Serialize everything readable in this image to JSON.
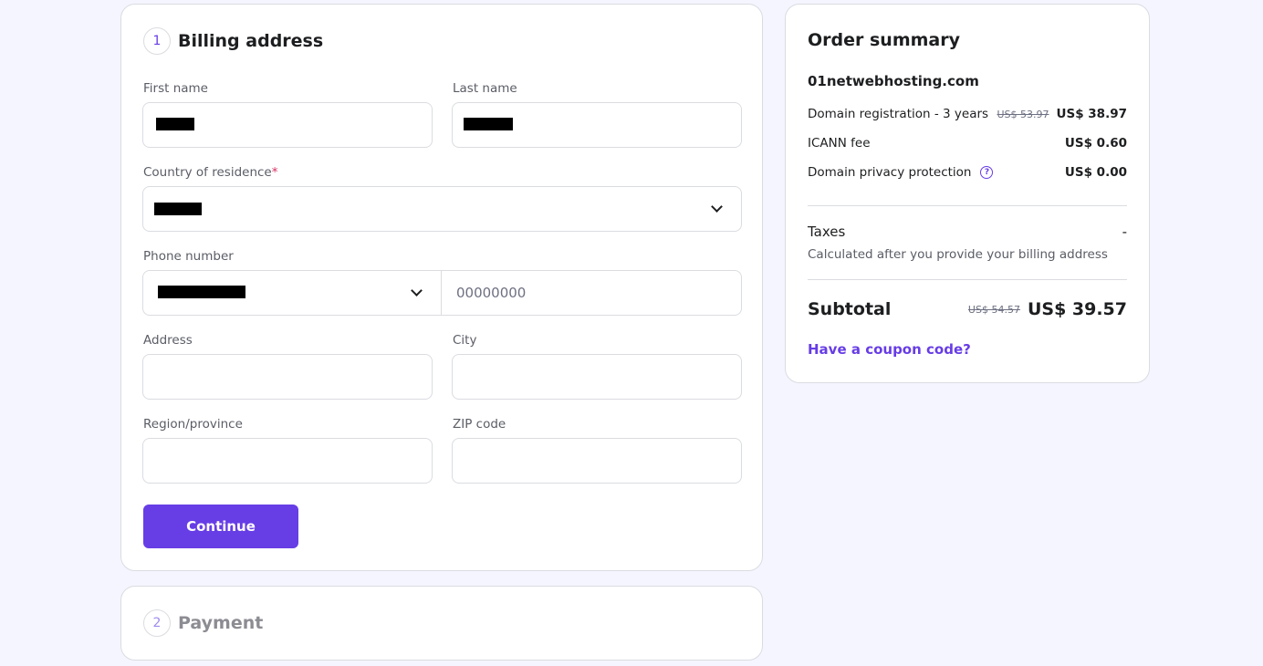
{
  "billing": {
    "step_number": "1",
    "title": "Billing address",
    "first_name_label": "First name",
    "last_name_label": "Last name",
    "country_label": "Country of residence",
    "required_marker": "*",
    "phone_label": "Phone number",
    "phone_placeholder": "00000000",
    "address_label": "Address",
    "city_label": "City",
    "region_label": "Region/province",
    "zip_label": "ZIP code",
    "continue_label": "Continue"
  },
  "payment": {
    "step_number": "2",
    "title": "Payment"
  },
  "summary": {
    "title": "Order summary",
    "domain": "01netwebhosting.com",
    "items": [
      {
        "label": "Domain registration - 3 years",
        "old_price": "US$ 53.97",
        "price": "US$ 38.97"
      },
      {
        "label": "ICANN fee",
        "old_price": "",
        "price": "US$ 0.60"
      },
      {
        "label": "Domain privacy protection",
        "old_price": "",
        "price": "US$ 0.00",
        "help_icon": "question-icon"
      }
    ],
    "taxes_label": "Taxes",
    "taxes_value": "-",
    "taxes_note": "Calculated after you provide your billing address",
    "subtotal_label": "Subtotal",
    "subtotal_old": "US$ 54.57",
    "subtotal_price": "US$ 39.57",
    "coupon_label": "Have a coupon code?"
  },
  "colors": {
    "accent": "#673de6",
    "background": "#f4f5ff"
  }
}
